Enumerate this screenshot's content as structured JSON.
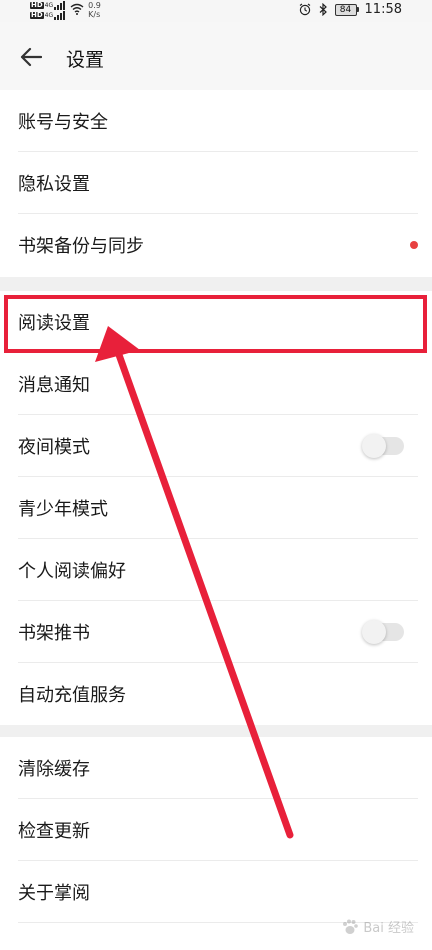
{
  "status_bar": {
    "hd_label": "HD",
    "network_label": "4G",
    "speed_value": "0.9",
    "speed_unit": "K/s",
    "battery_level": "84",
    "time": "11:58"
  },
  "header": {
    "title": "设置"
  },
  "sections": [
    {
      "items": [
        {
          "label": "账号与安全"
        },
        {
          "label": "隐私设置"
        },
        {
          "label": "书架备份与同步",
          "badge": "red-dot"
        }
      ]
    },
    {
      "items": [
        {
          "label": "阅读设置"
        },
        {
          "label": "消息通知"
        },
        {
          "label": "夜间模式",
          "toggle": false
        },
        {
          "label": "青少年模式"
        },
        {
          "label": "个人阅读偏好"
        },
        {
          "label": "书架推书",
          "toggle": false
        },
        {
          "label": "自动充值服务"
        }
      ]
    },
    {
      "items": [
        {
          "label": "清除缓存"
        },
        {
          "label": "检查更新"
        },
        {
          "label": "关于掌阅"
        }
      ]
    }
  ],
  "watermark": "Bai 经验",
  "colors": {
    "highlight": "#e8203a",
    "badge": "#e84141",
    "section_gap": "#f0f0f0"
  }
}
